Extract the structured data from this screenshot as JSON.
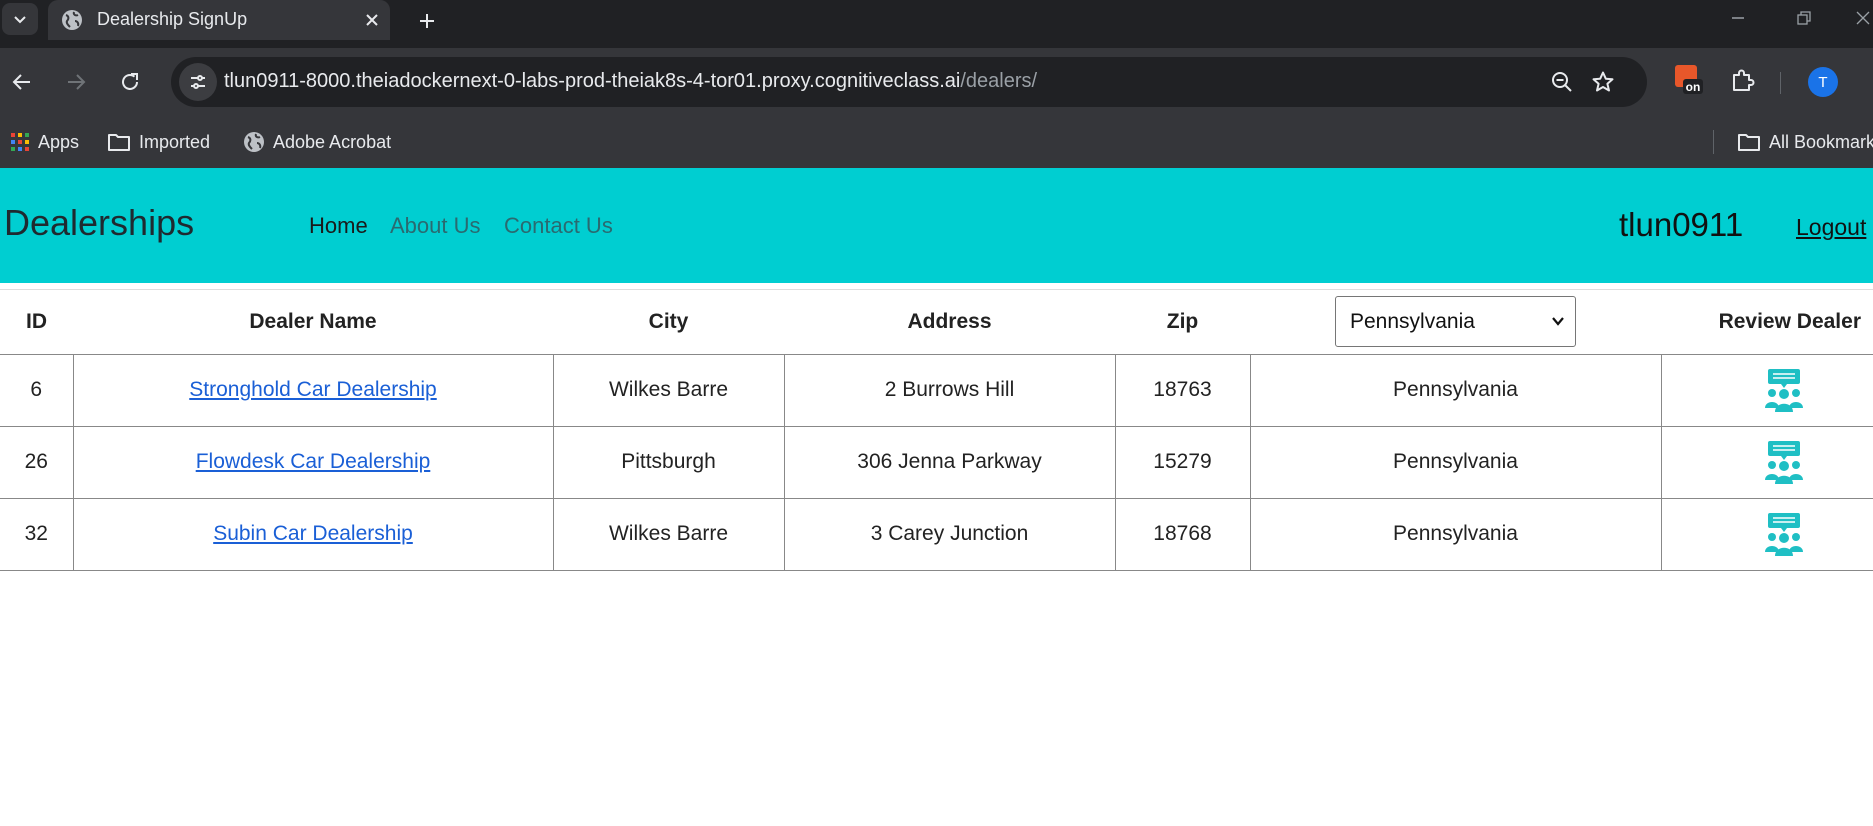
{
  "browser": {
    "tab_title": "Dealership SignUp",
    "url_host": "tlun0911-8000.theiadockernext-0-labs-prod-theiak8s-4-tor01.proxy.cognitiveclass.ai",
    "url_path": "/dealers/",
    "profile_initial": "T",
    "extension_badge": "on",
    "bookmarks": [
      {
        "label": "Apps",
        "icon": "apps-grid-icon"
      },
      {
        "label": "Imported",
        "icon": "folder-icon"
      },
      {
        "label": "Adobe Acrobat",
        "icon": "globe-icon"
      }
    ],
    "all_bookmarks_label": "All Bookmarks"
  },
  "navbar": {
    "brand": "Dealerships",
    "links": [
      "Home",
      "About Us",
      "Contact Us"
    ],
    "username": "tlun0911",
    "logout": "Logout",
    "bg_color": "#00ced1"
  },
  "table": {
    "headers": {
      "id": "ID",
      "name": "Dealer Name",
      "city": "City",
      "address": "Address",
      "zip": "Zip",
      "review": "Review Dealer"
    },
    "state_filter": "Pennsylvania",
    "rows": [
      {
        "id": "6",
        "name": "Stronghold Car Dealership",
        "city": "Wilkes Barre",
        "address": "2 Burrows Hill",
        "zip": "18763",
        "state": "Pennsylvania"
      },
      {
        "id": "26",
        "name": "Flowdesk Car Dealership",
        "city": "Pittsburgh",
        "address": "306 Jenna Parkway",
        "zip": "15279",
        "state": "Pennsylvania"
      },
      {
        "id": "32",
        "name": "Subin Car Dealership",
        "city": "Wilkes Barre",
        "address": "3 Carey Junction",
        "zip": "18768",
        "state": "Pennsylvania"
      }
    ],
    "link_color": "#1a5fd6",
    "review_icon": "review-people-icon",
    "review_icon_color": "#1fbfc4"
  }
}
